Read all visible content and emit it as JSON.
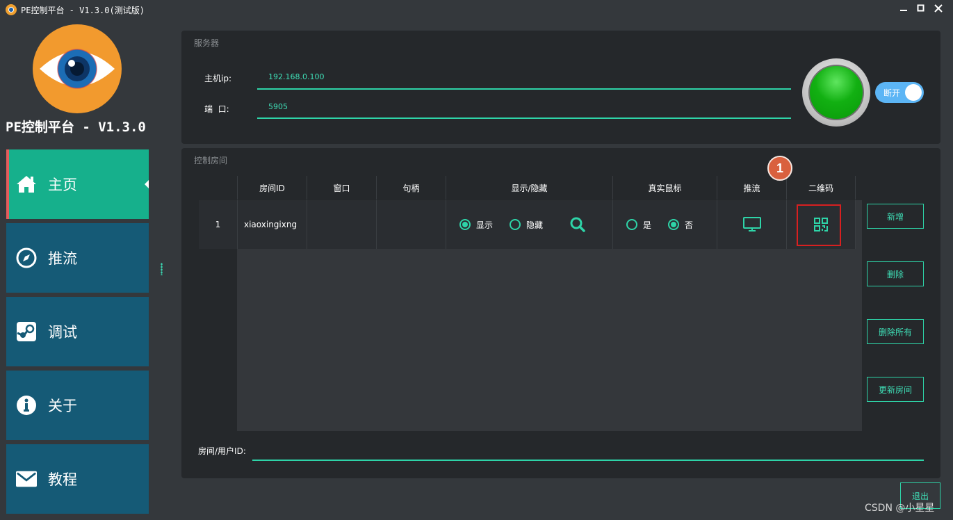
{
  "window": {
    "title": "PE控制平台 - V1.3.0(测试版)",
    "icon": "eye-icon",
    "controls": [
      "minimize-icon",
      "maximize-icon",
      "close-icon"
    ]
  },
  "sidebar": {
    "brand": "PE控制平台 - V1.3.0",
    "items": [
      {
        "label": "主页",
        "icon": "home-icon",
        "active": true
      },
      {
        "label": "推流",
        "icon": "compass-icon",
        "active": false
      },
      {
        "label": "调试",
        "icon": "steam-icon",
        "active": false
      },
      {
        "label": "关于",
        "icon": "info-icon",
        "active": false
      },
      {
        "label": "教程",
        "icon": "mail-icon",
        "active": false
      }
    ]
  },
  "server": {
    "title": "服务器",
    "host_label": "主机ip:",
    "host_value": "192.168.0.100",
    "port_label": "端  口:",
    "port_value": "5905",
    "status_color": "#12b012",
    "toggle_label": "断开"
  },
  "rooms": {
    "title": "控制房间",
    "columns": [
      "房间ID",
      "窗口",
      "句柄",
      "显示/隐藏",
      "真实鼠标",
      "推流",
      "二维码"
    ],
    "rows": [
      {
        "index": "1",
        "room_id": "xiaoxingixng",
        "window": "",
        "handle": "",
        "display_options": [
          "显示",
          "隐藏"
        ],
        "display_selected": "显示",
        "mouse_options": [
          "是",
          "否"
        ],
        "mouse_selected": "否"
      }
    ],
    "buttons": {
      "add": "新增",
      "delete": "删除",
      "delete_all": "删除所有",
      "update": "更新房间"
    },
    "user_id_label": "房间/用户ID:",
    "user_id_value": ""
  },
  "annotation": {
    "number": "1",
    "color": "#d9603e"
  },
  "exit_label": "退出",
  "watermark": "CSDN @小星星",
  "colors": {
    "accent": "#2ed4a8",
    "nav_active": "#16b08c",
    "nav": "#155a76",
    "panel": "#25282b"
  }
}
